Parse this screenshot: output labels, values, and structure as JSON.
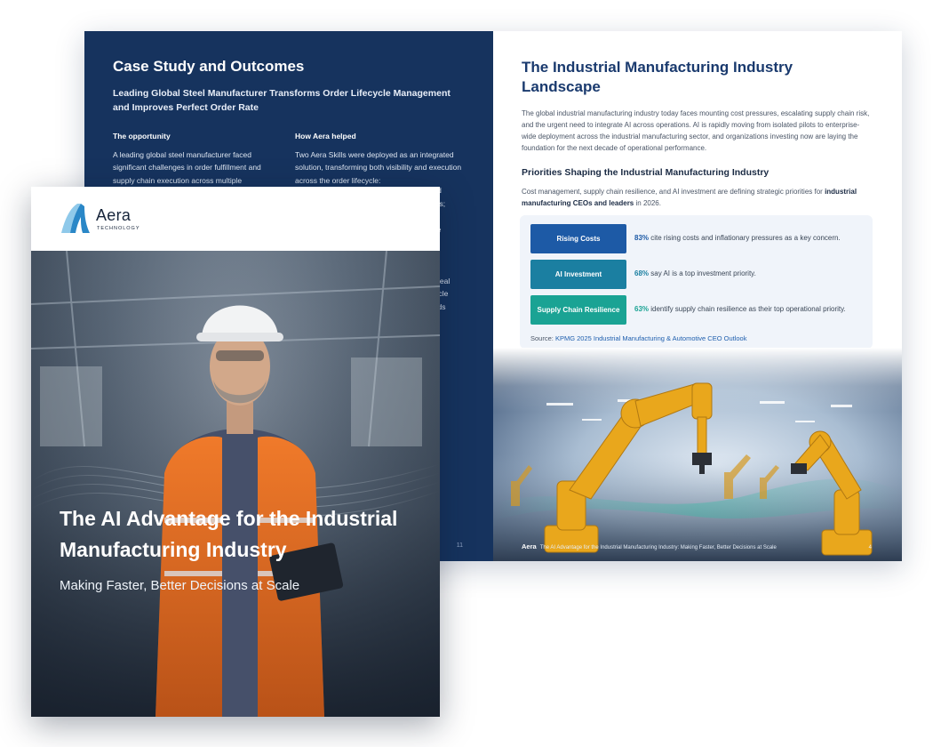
{
  "left_page": {
    "title": "Case Study and Outcomes",
    "subtitle": "Leading Global Steel Manufacturer Transforms Order Lifecycle Management and Improves Perfect Order Rate",
    "opportunity_heading": "The opportunity",
    "opportunity_text": "A leading global steel manufacturer faced significant challenges in order fulfillment and supply chain execution across multiple",
    "help_heading": "How Aera helped",
    "help_text": "Two Aera Skills were deployed as an integrated solution, transforming both visibility and execution across the order lifecycle:",
    "help_fragments": [
      "ted",
      "ges;",
      "ule",
      "nd",
      "ne",
      "n real",
      "cycle",
      "ards"
    ],
    "page_number": "11"
  },
  "right_page": {
    "title": "The Industrial Manufacturing Industry Landscape",
    "body": "The global industrial manufacturing industry today faces mounting cost pressures, escalating supply chain risk, and the urgent need to integrate AI across operations. AI is rapidly moving from isolated pilots to enterprise-wide deployment across the industrial manufacturing sector, and organizations investing now are laying the foundation for the next decade of operational performance.",
    "priorities_heading": "Priorities Shaping the Industrial Manufacturing Industry",
    "priorities_lead_start": "Cost management, supply chain resilience, and AI investment are defining strategic priorities for ",
    "priorities_lead_bold": "industrial manufacturing CEOs and leaders",
    "priorities_lead_end": " in 2026.",
    "stats": [
      {
        "label": "Rising Costs",
        "pct": "83%",
        "text": " cite rising costs and inflationary pressures as a key concern.",
        "color": "#1d5aa6"
      },
      {
        "label": "AI Investment",
        "pct": "68%",
        "text": " say AI is a top investment priority.",
        "color": "#1b7fa1"
      },
      {
        "label": "Supply Chain Resilience",
        "pct": "63%",
        "text": " identify supply chain resilience as their top operational priority.",
        "color": "#1aa394"
      }
    ],
    "source_label": "Source: ",
    "source_link": "KPMG 2025 Industrial Manufacturing & Automotive CEO Outlook",
    "footer_logo": "Aera",
    "footer_text": "The AI Advantage for the Industrial Manufacturing Industry: Making Faster, Better Decisions at Scale",
    "page_number": "4"
  },
  "cover": {
    "brand": "Aera",
    "brand_sub": "TECHNOLOGY",
    "title": "The AI Advantage for the Industrial Manufacturing Industry",
    "subtitle": "Making Faster, Better Decisions at Scale"
  },
  "colors": {
    "navy": "#16335e",
    "title_blue": "#1a3a6e",
    "robot_yellow": "#e9a71c"
  }
}
